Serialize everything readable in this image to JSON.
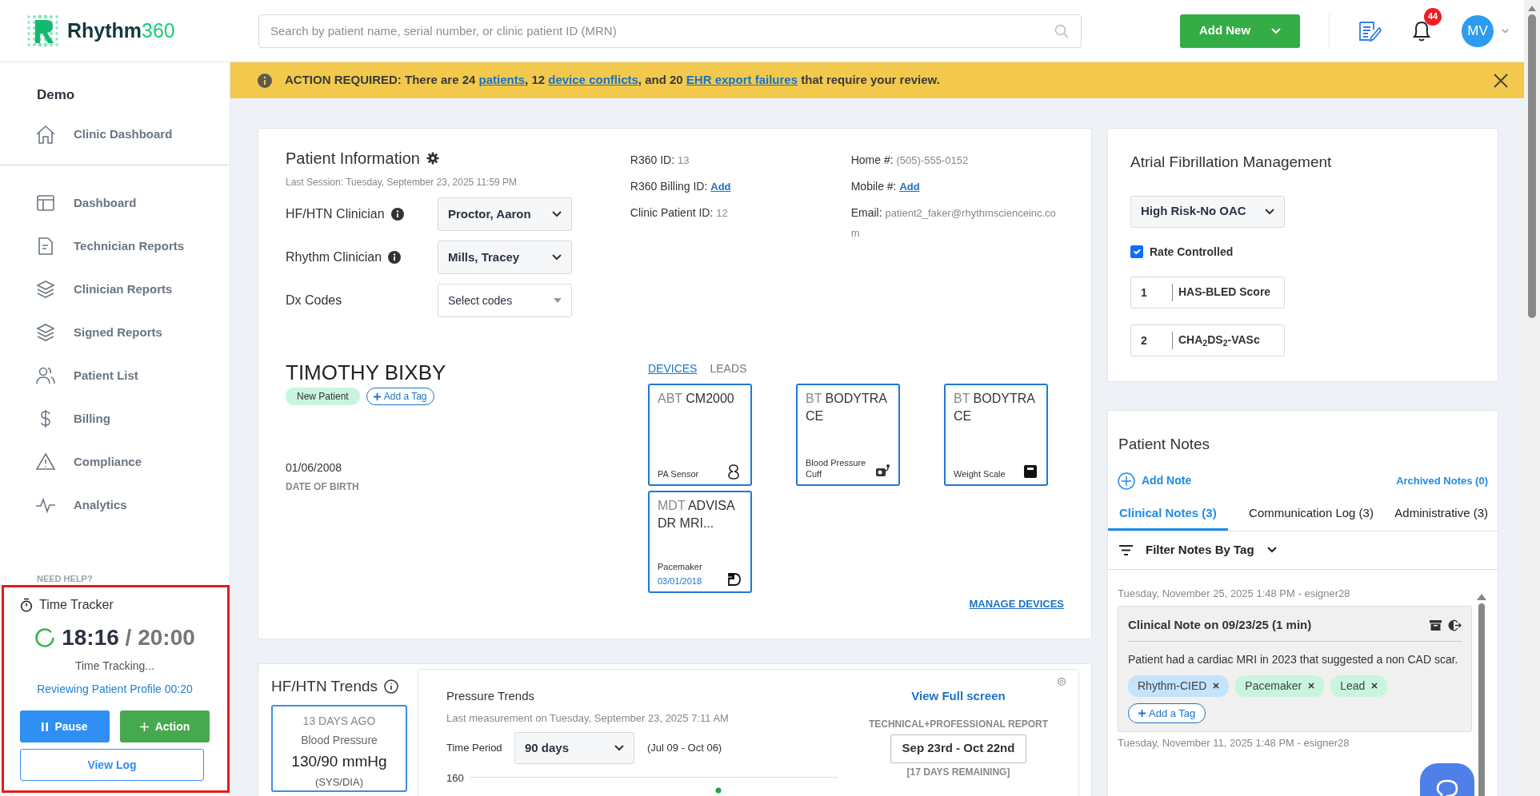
{
  "header": {
    "logo": {
      "word": "Rhythm",
      "number": "360"
    },
    "search": {
      "placeholder": "Search by patient name, serial number, or clinic patient ID (MRN)"
    },
    "add_button": "Add New",
    "notification_count": "44",
    "avatar": "MV"
  },
  "sidebar": {
    "clinic": "Demo",
    "clinic_link": "Clinic Dashboard",
    "items": [
      {
        "label": "Dashboard"
      },
      {
        "label": "Technician Reports"
      },
      {
        "label": "Clinician Reports"
      },
      {
        "label": "Signed Reports"
      },
      {
        "label": "Patient List"
      },
      {
        "label": "Billing"
      },
      {
        "label": "Compliance"
      },
      {
        "label": "Analytics"
      }
    ],
    "help": "NEED HELP?"
  },
  "time_tracker": {
    "title": "Time Tracker",
    "elapsed": "18:16",
    "separator": " / ",
    "limit": "20:00",
    "status": "Time Tracking...",
    "activity": "Reviewing Patient Profile 00:20",
    "pause": "Pause",
    "action": "Action",
    "view_log": "View Log"
  },
  "banner": {
    "parts": [
      {
        "text": "ACTION REQUIRED: There are 24 ",
        "link": false
      },
      {
        "text": "patients",
        "link": true
      },
      {
        "text": ", 12 ",
        "link": false
      },
      {
        "text": "device conflicts",
        "link": true
      },
      {
        "text": ", and 20 ",
        "link": false
      },
      {
        "text": "EHR export failures",
        "link": true
      },
      {
        "text": " that require your review.",
        "link": false
      }
    ]
  },
  "patient_info": {
    "title": "Patient Information",
    "last_session": "Last Session: Tuesday, September 23, 2025 11:59 PM",
    "fields": [
      {
        "label": "HF/HTN Clinician",
        "info": true,
        "value": "Proctor, Aaron",
        "placeholder": false
      },
      {
        "label": "Rhythm Clinician",
        "info": true,
        "value": "Mills, Tracey",
        "placeholder": false
      },
      {
        "label": "Dx Codes",
        "info": false,
        "value": "Select codes",
        "placeholder": true
      }
    ],
    "ids": [
      {
        "label": "R360 ID:",
        "value": "13",
        "link": false
      },
      {
        "label": "R360 Billing ID:",
        "value": "Add",
        "link": true
      },
      {
        "label": "Clinic Patient ID:",
        "value": "12",
        "link": false
      }
    ],
    "contacts": [
      {
        "label": "Home #:",
        "value": "(505)-555-0152",
        "link": false
      },
      {
        "label": "Mobile #:",
        "value": "Add",
        "link": true
      },
      {
        "label": "Email:",
        "value": "patient2_faker@rhythmscienceinc.com",
        "link": false
      }
    ],
    "name": "TIMOTHY BIXBY",
    "tag": "New Patient",
    "add_tag": "Add a Tag",
    "dob": "01/06/2008",
    "dob_label": "DATE OF BIRTH",
    "device_tabs": [
      {
        "label": "DEVICES",
        "selected": true
      },
      {
        "label": "LEADS",
        "selected": false
      }
    ],
    "devices": [
      {
        "maker": "ABT",
        "model": "CM2000",
        "type": "PA Sensor"
      },
      {
        "maker": "BT",
        "model": "BODYTRACE",
        "type": "Blood Pressure Cuff"
      },
      {
        "maker": "BT",
        "model": "BODYTRACE",
        "type": "Weight Scale"
      },
      {
        "maker": "MDT",
        "model": "ADVISA DR MRI...",
        "type": "Pacemaker",
        "date": "03/01/2018"
      }
    ],
    "manage": "MANAGE DEVICES"
  },
  "trends": {
    "title": "HF/HTN Trends",
    "summary": {
      "age": "13 DAYS AGO",
      "kind": "Blood Pressure",
      "value": "130/90 mmHg",
      "unit": "(SYS/DIA)"
    },
    "chart_title": "Pressure Trends",
    "last_measurement": "Last measurement on Tuesday, September 23, 2025 7:11 AM",
    "period_label": "Time Period",
    "period": "90 days",
    "range": "(Jul 09 - Oct 06)",
    "full_screen": "View Full screen",
    "report_label": "TECHNICAL+PROFESSIONAL REPORT",
    "report_range": "Sep 23rd - Oct 22nd",
    "remaining": "[17 DAYS REMAINING]",
    "axis_tick": "160"
  },
  "af": {
    "title": "Atrial Fibrillation Management",
    "risk": "High Risk-No OAC",
    "rate_controlled": {
      "label": "Rate Controlled",
      "checked": true
    },
    "scores": [
      {
        "value": "1",
        "label": "HAS-BLED Score"
      },
      {
        "value": "2",
        "label": "CHA$_{2}$DS$_{2}$-VASc"
      }
    ]
  },
  "notes": {
    "title": "Patient Notes",
    "add": "Add Note",
    "archived": "Archived Notes (0)",
    "tabs": [
      {
        "label": "Clinical Notes (3)",
        "selected": true
      },
      {
        "label": "Communication Log (3)",
        "selected": false
      },
      {
        "label": "Administrative (3)",
        "selected": false
      }
    ],
    "filter": "Filter Notes By Tag",
    "entries": [
      {
        "meta": "Tuesday, November 25, 2025 1:48 PM - esigner28",
        "title": "Clinical Note on 09/23/25 (1 min)",
        "text": "Patient had a cardiac MRI in 2023 that suggested a non CAD scar.",
        "tags": [
          {
            "label": "Rhythm-CIED",
            "color": "#c5e3fb"
          },
          {
            "label": "Pacemaker",
            "color": "#c9f5df"
          },
          {
            "label": "Lead",
            "color": "#c9f5df"
          }
        ],
        "add_tag": "Add a Tag"
      },
      {
        "meta": "Tuesday, November 11, 2025 1:48 PM - esigner28"
      }
    ]
  }
}
